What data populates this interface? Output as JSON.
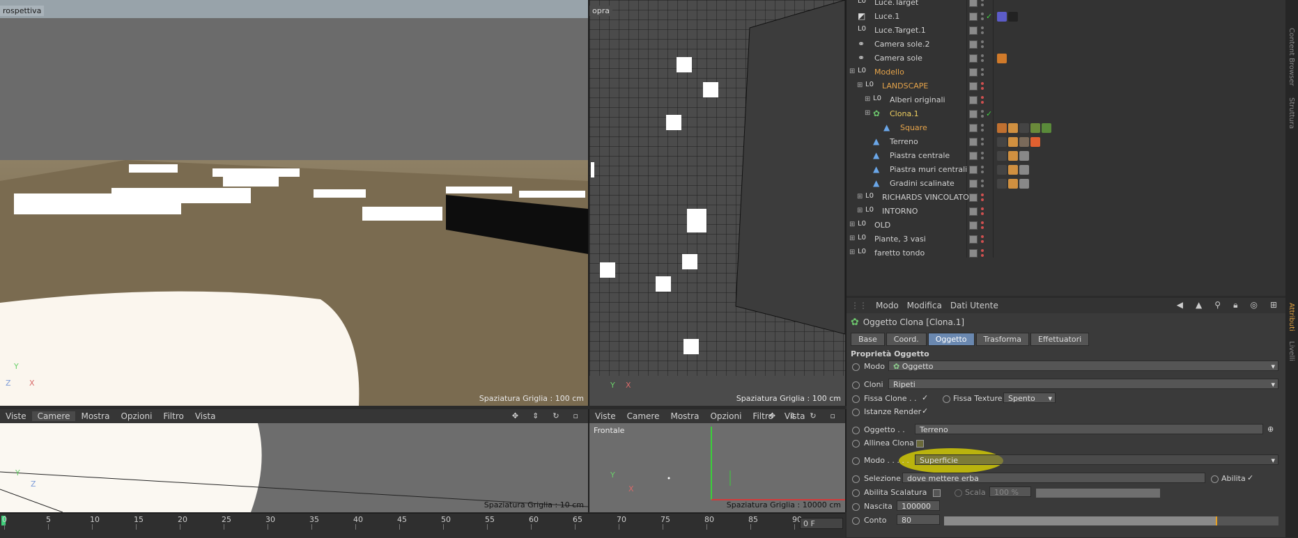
{
  "viewports": {
    "perspective": {
      "label": "rospettiva",
      "grid_note": "Spaziatura Griglia : 100 cm"
    },
    "top": {
      "label": "opra",
      "grid_note": "Spaziatura Griglia : 100 cm"
    },
    "bottom_left": {
      "menu": [
        "Viste",
        "Camere",
        "Mostra",
        "Opzioni",
        "Filtro",
        "Vista"
      ],
      "grid_note": "Spaziatura Griglia : 10 cm"
    },
    "bottom_mid": {
      "menu": [
        "Viste",
        "Camere",
        "Mostra",
        "Opzioni",
        "Filtro",
        "Vista"
      ],
      "label": "Frontale",
      "grid_note": "Spaziatura Griglia : 10000 cm"
    },
    "axes": {
      "x": "X",
      "y": "Y",
      "z": "Z"
    }
  },
  "timeline": {
    "ticks": [
      "0",
      "5",
      "10",
      "15",
      "20",
      "25",
      "30",
      "35",
      "40",
      "45",
      "50",
      "55",
      "60",
      "65",
      "70",
      "75",
      "80",
      "85",
      "90"
    ],
    "frame_field": "0 F"
  },
  "object_manager": {
    "objects": [
      {
        "name": "Luce.Target"
      },
      {
        "name": "Luce.1"
      },
      {
        "name": "Luce.Target.1"
      },
      {
        "name": "Camera sole.2"
      },
      {
        "name": "Camera sole"
      },
      {
        "name": "Modello"
      },
      {
        "name": "LANDSCAPE"
      },
      {
        "name": "Alberi originali"
      },
      {
        "name": "Clona.1"
      },
      {
        "name": "Square"
      },
      {
        "name": "Terreno"
      },
      {
        "name": "Piastra centrale"
      },
      {
        "name": "Piastra muri centrali"
      },
      {
        "name": "Gradini scalinate"
      },
      {
        "name": "RICHARDS VINCOLATO"
      },
      {
        "name": "INTORNO"
      },
      {
        "name": "OLD"
      },
      {
        "name": "Piante, 3 vasi"
      },
      {
        "name": "faretto tondo"
      }
    ]
  },
  "attributes": {
    "menu": [
      "Modo",
      "Modifica",
      "Dati Utente"
    ],
    "title": "Oggetto Clona [Clona.1]",
    "tabs": [
      "Base",
      "Coord.",
      "Oggetto",
      "Trasforma",
      "Effettuatori"
    ],
    "section": "Proprietà Oggetto",
    "modo_label": "Modo",
    "modo_value": "Oggetto",
    "cloni_label": "Cloni",
    "cloni_value": "Ripeti",
    "fissa_clone_label": "Fissa Clone . .",
    "fissa_texture_label": "Fissa Texture",
    "fissa_texture_value": "Spento",
    "istanze_render_label": "Istanze Render",
    "oggetto_label": "Oggetto . .",
    "oggetto_value": "Terreno",
    "allinea_label": "Allinea Clona",
    "modo2_label": "Modo . . . . .",
    "modo2_value": "Superficie",
    "selezione_label": "Selezione",
    "selezione_value": "dove mettere erba",
    "abilita_label": "Abilita",
    "abilita_scalatura_label": "Abilita Scalatura",
    "scala_label": "Scala",
    "scala_value": "100 %",
    "nascita_label": "Nascita",
    "nascita_value": "100000",
    "conto_label": "Conto",
    "conto_value": "80"
  },
  "side_tabs": [
    "Content Browser",
    "Struttura",
    "Attributi",
    "Livelli"
  ]
}
